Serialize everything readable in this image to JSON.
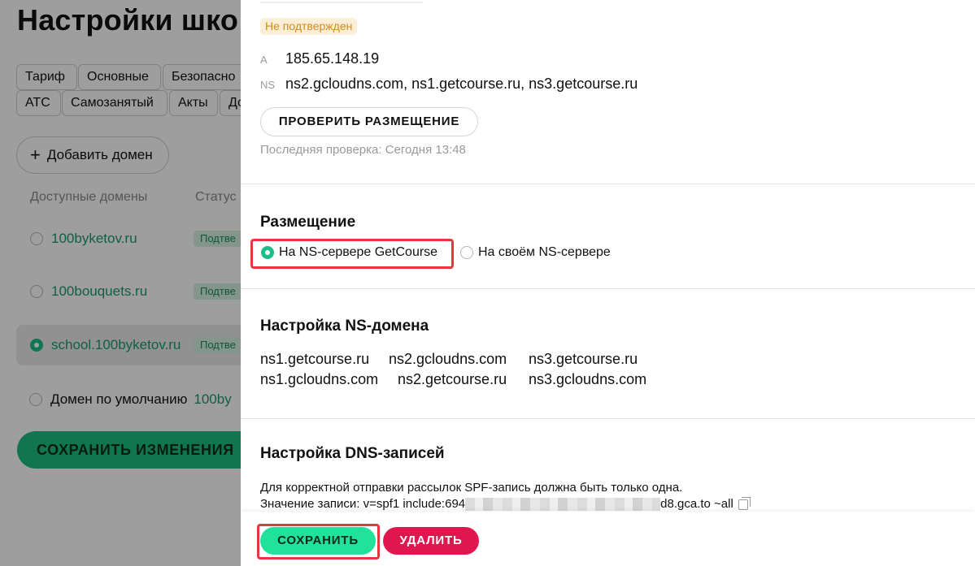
{
  "background": {
    "page_title": "Настройки шко",
    "tabs_row1": [
      "Тариф",
      "Основные",
      "Безопасно"
    ],
    "tabs_row2": [
      "АТС",
      "Самозанятый",
      "Акты",
      "До"
    ],
    "add_domain_label": "Добавить домен",
    "columns": {
      "domains": "Доступные домены",
      "status": "Статус"
    },
    "domains": [
      {
        "name": "100byketov.ru",
        "status": "Подтве",
        "selected": false
      },
      {
        "name": "100bouquets.ru",
        "status": "Подтве",
        "selected": false
      },
      {
        "name": "school.100byketov.ru",
        "status": "Подтве",
        "selected": true
      }
    ],
    "default_domain": {
      "label": "Домен по умолчанию",
      "value": "100by"
    },
    "save_changes_label": "СОХРАНИТЬ ИЗМЕНЕНИЯ"
  },
  "panel": {
    "status_badge": "Не подтвержден",
    "records": [
      {
        "type": "A",
        "value": "185.65.148.19"
      },
      {
        "type": "NS",
        "value": "ns2.gcloudns.com, ns1.getcourse.ru, ns3.getcourse.ru"
      }
    ],
    "check_button": "ПРОВЕРИТЬ РАЗМЕЩЕНИЕ",
    "last_check": "Последняя проверка: Сегодня 13:48",
    "placement": {
      "title": "Размещение",
      "options": [
        {
          "label": "На NS-сервере GetCourse",
          "selected": true
        },
        {
          "label": "На своём NS-сервере",
          "selected": false
        }
      ]
    },
    "ns_setup": {
      "title": "Настройка NS-домена",
      "row1": [
        "ns1.getcourse.ru",
        "ns2.gcloudns.com",
        "ns3.getcourse.ru"
      ],
      "row2": [
        "ns1.gcloudns.com",
        "ns2.getcourse.ru",
        "ns3.gcloudns.com"
      ]
    },
    "dns_setup": {
      "title": "Настройка DNS-записей",
      "note": "Для корректной отправки рассылок SPF-запись должна быть только одна.",
      "value_prefix": "Значение записи: v=spf1 include:694",
      "value_suffix": "d8.gca.to ~all"
    },
    "save_button": "СОХРАНИТЬ",
    "delete_button": "УДАЛИТЬ"
  },
  "colors": {
    "accent": "#1bbf85",
    "danger": "#e0174e",
    "highlight": "#e2393f",
    "warning": "#d38a18"
  }
}
